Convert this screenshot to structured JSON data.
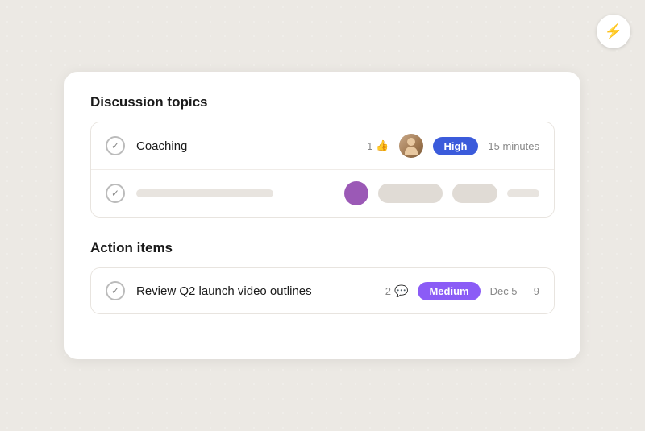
{
  "lightning_button": {
    "aria_label": "Lightning actions",
    "icon": "⚡"
  },
  "discussion_section": {
    "title": "Discussion topics",
    "items": [
      {
        "id": "coaching",
        "title": "Coaching",
        "like_count": "1",
        "priority": "High",
        "priority_class": "high",
        "duration": "15 minutes",
        "has_avatar": true,
        "checked": true
      },
      {
        "id": "placeholder",
        "title": "",
        "is_skeleton": true,
        "checked": true
      }
    ]
  },
  "action_section": {
    "title": "Action items",
    "items": [
      {
        "id": "review-q2",
        "title": "Review Q2 launch video outlines",
        "comment_count": "2",
        "priority": "Medium",
        "priority_class": "medium",
        "date_range": "Dec 5 — 9",
        "checked": true
      }
    ]
  }
}
